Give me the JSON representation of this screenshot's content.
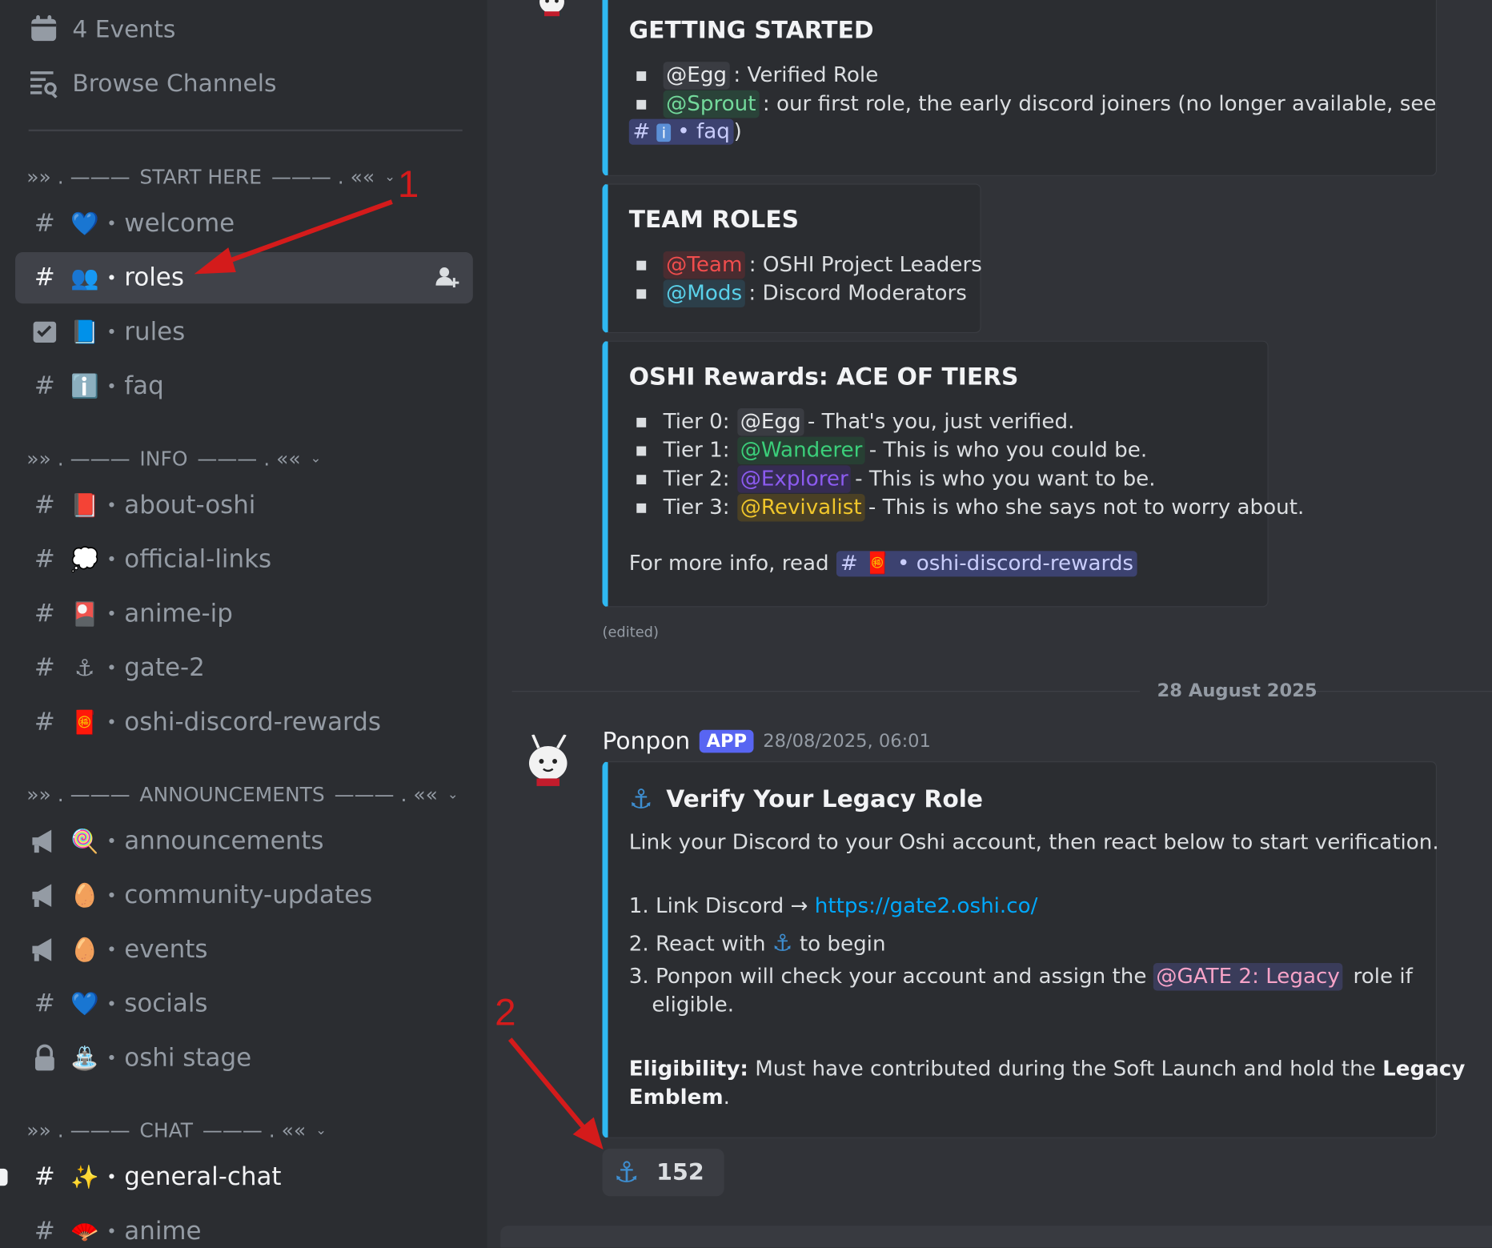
{
  "sidebar": {
    "events_label": "4 Events",
    "browse_label": "Browse Channels",
    "categories": [
      {
        "prefix": "»» . ——— ",
        "name": "START HERE",
        "suffix": " ——— . ««"
      },
      {
        "prefix": "»» . ——— ",
        "name": "INFO",
        "suffix": " ——— . ««"
      },
      {
        "prefix": "»» . ——— ",
        "name": "ANNOUNCEMENTS",
        "suffix": " ——— . ««"
      },
      {
        "prefix": "»» . ——— ",
        "name": "CHAT",
        "suffix": " ——— . ««"
      }
    ],
    "channels": [
      {
        "icon": "hash-icon",
        "emoji": "💙",
        "name": "welcome"
      },
      {
        "icon": "hash-lock-icon",
        "emoji": "👥",
        "name": "roles"
      },
      {
        "icon": "rules-icon",
        "emoji": "📘",
        "name": "rules"
      },
      {
        "icon": "hash-icon",
        "emoji": "ℹ️",
        "name": "faq"
      },
      {
        "icon": "hash-lock-icon",
        "emoji": "📕",
        "name": "about-oshi"
      },
      {
        "icon": "hash-lock-icon",
        "emoji": "💭",
        "name": "official-links"
      },
      {
        "icon": "hash-lock-icon",
        "emoji": "🎴",
        "name": "anime-ip"
      },
      {
        "icon": "hash-lock-icon",
        "emoji": "⚓",
        "name": "gate-2"
      },
      {
        "icon": "hash-lock-icon",
        "emoji": "🧧",
        "name": "oshi-discord-rewards"
      },
      {
        "icon": "megaphone-icon",
        "emoji": "🍭",
        "name": "announcements"
      },
      {
        "icon": "megaphone-icon",
        "emoji": "🥚",
        "name": "community-updates"
      },
      {
        "icon": "megaphone-icon",
        "emoji": "🥚",
        "name": "events"
      },
      {
        "icon": "hash-icon",
        "emoji": "💙",
        "name": "socials"
      },
      {
        "icon": "lock-icon",
        "emoji": "⛲",
        "name": "oshi stage"
      },
      {
        "icon": "hash-lock-icon",
        "emoji": "✨",
        "name": "general-chat"
      },
      {
        "icon": "hash-lock-icon",
        "emoji": "🪭",
        "name": "anime"
      }
    ]
  },
  "embeds": {
    "getting_started": {
      "title": "GETTING STARTED",
      "egg_mention": "@Egg",
      "egg_text": ": Verified Role",
      "sprout_mention": "@Sprout",
      "sprout_text": ": our first role, the early discord joiners (no longer available, see",
      "faq_channel": "faq",
      "faq_close": ")"
    },
    "team_roles": {
      "title": "TEAM ROLES",
      "team_mention": "@Team",
      "team_text": ": OSHI Project Leaders",
      "mods_mention": "@Mods",
      "mods_text": ": Discord Moderators"
    },
    "rewards": {
      "title": "OSHI Rewards: ACE OF TIERS",
      "tiers": [
        {
          "label": "Tier 0:",
          "mention": "@Egg",
          "text": "- That's you, just verified."
        },
        {
          "label": "Tier 1:",
          "mention": "@Wanderer",
          "text": "- This is who you could be."
        },
        {
          "label": "Tier 2:",
          "mention": "@Explorer",
          "text": "- This is who you want to be."
        },
        {
          "label": "Tier 3:",
          "mention": "@Revivalist",
          "text": "- This is who she says not to worry about."
        }
      ],
      "more_info": "For more info, read",
      "channel": "oshi-discord-rewards"
    },
    "edited": "(edited)"
  },
  "date_divider": "28 August 2025",
  "message": {
    "author": "Ponpon",
    "badge": "APP",
    "timestamp": "28/08/2025, 06:01",
    "embed_title": "Verify Your Legacy Role",
    "intro": "Link your Discord to your Oshi account, then react below to start verification.",
    "step1_prefix": "1. Link Discord →",
    "step1_link": "https://gate2.oshi.co/",
    "step2_prefix": "2. React with",
    "step2_suffix": "to begin",
    "step3_prefix": "3. Ponpon will check your account and assign the",
    "step3_mention": "@GATE 2: Legacy",
    "step3_suffix": "role if",
    "step3_line2": "eligible.",
    "elig_bold": "Eligibility:",
    "elig_text": "Must have contributed during the Soft Launch and hold the",
    "elig_bold2": "Legacy",
    "elig_bold3": "Emblem",
    "elig_end": ".",
    "reaction_count": "152"
  },
  "annotations": {
    "one": "1",
    "two": "2"
  },
  "colors": {
    "accent_bar": "#2fb8f1",
    "app_badge": "#5865f2",
    "annotation_red": "#d41b1b"
  }
}
